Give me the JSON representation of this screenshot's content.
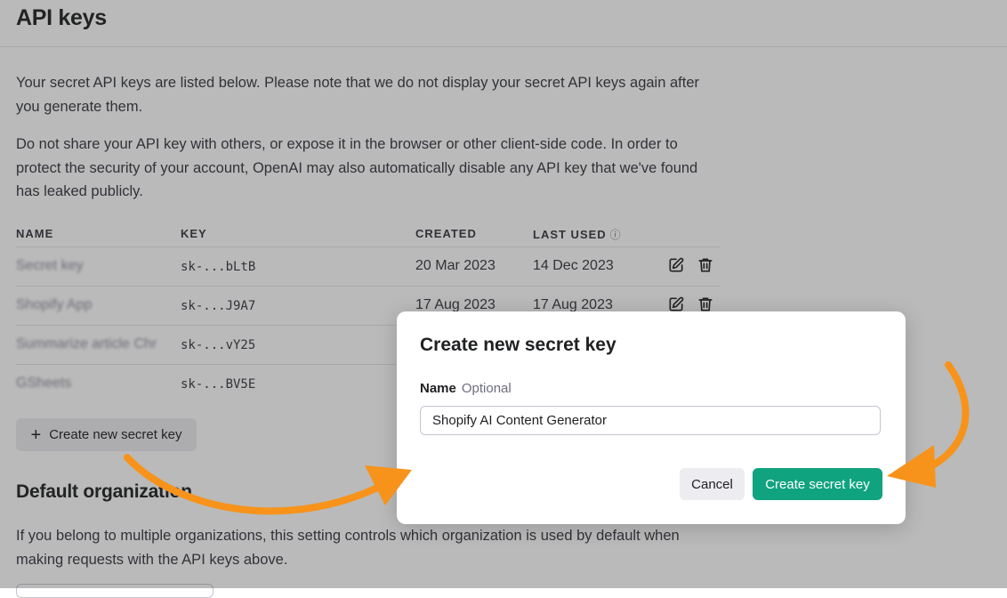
{
  "page": {
    "title": "API keys",
    "intro_1": "Your secret API keys are listed below. Please note that we do not display your secret API keys again after you generate them.",
    "intro_2": "Do not share your API key with others, or expose it in the browser or other client-side code. In order to protect the security of your account, OpenAI may also automatically disable any API key that we've found has leaked publicly."
  },
  "table": {
    "headers": {
      "name": "NAME",
      "key": "KEY",
      "created": "CREATED",
      "last_used": "LAST USED"
    },
    "rows": [
      {
        "name": "Secret key",
        "key": "sk-...bLtB",
        "created": "20 Mar 2023",
        "last_used": "14 Dec 2023"
      },
      {
        "name": "Shopify App",
        "key": "sk-...J9A7",
        "created": "17 Aug 2023",
        "last_used": "17 Aug 2023"
      },
      {
        "name": "Summarize article Chr",
        "key": "sk-...vY25",
        "created": "",
        "last_used": ""
      },
      {
        "name": "GSheets",
        "key": "sk-...BV5E",
        "created": "",
        "last_used": ""
      }
    ]
  },
  "create_button": {
    "label": "Create new secret key",
    "icon": "plus-icon"
  },
  "default_org": {
    "title": "Default organization",
    "description": "If you belong to multiple organizations, this setting controls which organization is used by default when making requests with the API keys above."
  },
  "modal": {
    "title": "Create new secret key",
    "field_label": "Name",
    "field_optional": "Optional",
    "field_value": "Shopify AI Content Generator",
    "cancel_label": "Cancel",
    "submit_label": "Create secret key"
  },
  "colors": {
    "accent": "#10a37f",
    "annotation_arrow": "#f7931a",
    "secondary_button": "#ececf1"
  }
}
